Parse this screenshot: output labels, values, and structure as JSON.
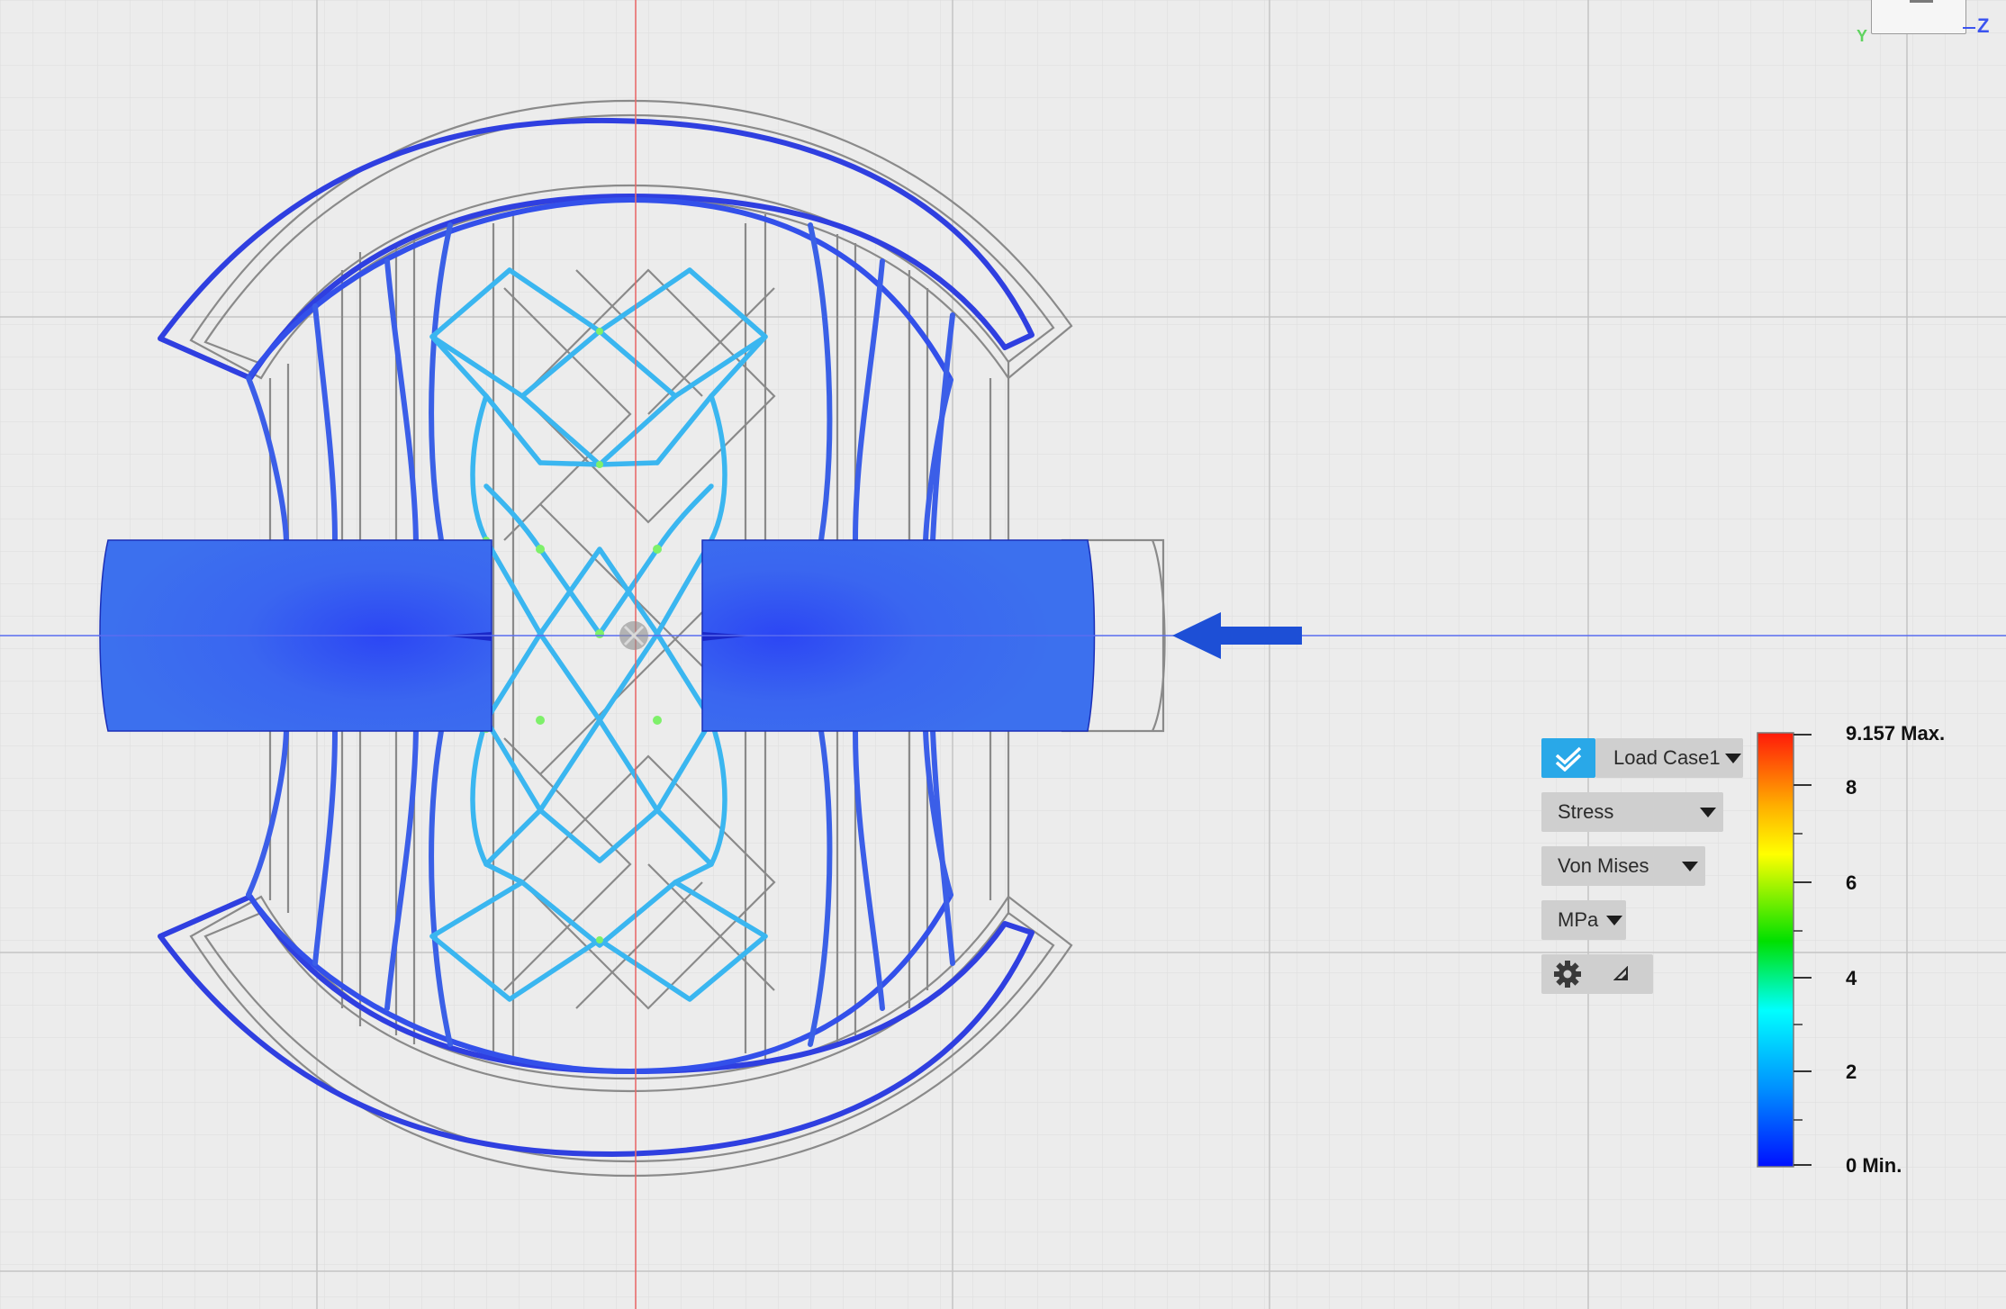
{
  "viewcube": {
    "face_label": "",
    "axis_y": "Y",
    "axis_z": "Z",
    "axis_y_color": "#5fd35f",
    "axis_z_color": "#3b54f0"
  },
  "viewport": {
    "background": "#ececec",
    "grid_color": "#d2d2d2",
    "x_axis_color": "#5a6cf0",
    "y_axis_color": "#e86565",
    "load_arrow_color": "#1d4fd6"
  },
  "panel": {
    "load_case": {
      "checked": true,
      "label": "Load Case1",
      "check_color": "#29a8e8"
    },
    "result_type": {
      "label": "Stress"
    },
    "stress_type": {
      "label": "Von Mises"
    },
    "units": {
      "label": "MPa"
    },
    "settings": {
      "icon": "gear-icon",
      "expand_icon": "corner-triangle-icon"
    }
  },
  "legend": {
    "max_label": "9.157 Max.",
    "min_label": "0 Min.",
    "max_value": 9.157,
    "min_value": 0,
    "ticks": [
      "8",
      "6",
      "4",
      "2"
    ],
    "tick_values": [
      8,
      6,
      4,
      2
    ],
    "colors": [
      "#ff2a0a",
      "#ffb400",
      "#ffff00",
      "#00e000",
      "#00ffff",
      "#0090ff",
      "#0000ff"
    ]
  }
}
